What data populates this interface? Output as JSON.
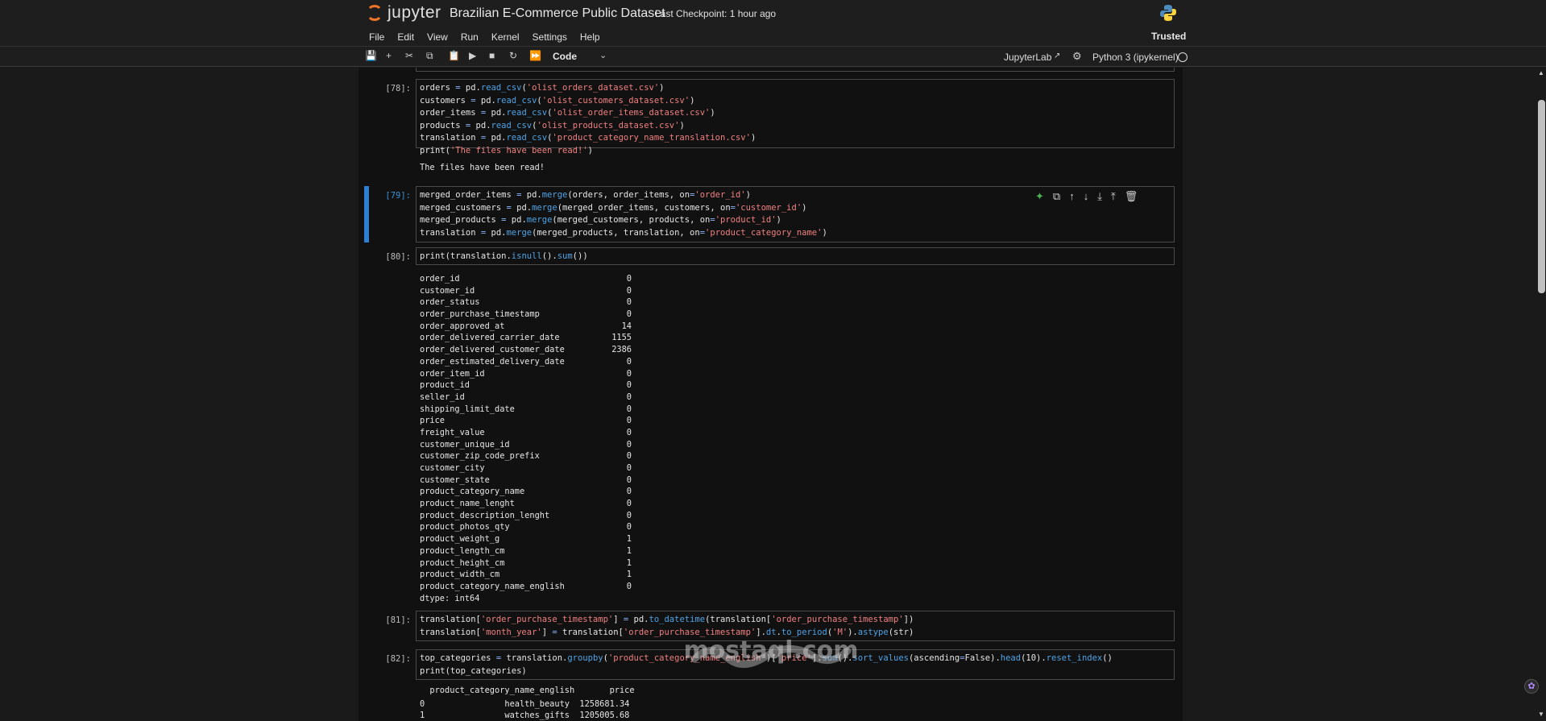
{
  "header": {
    "logo_text": "jupyter",
    "notebook_title": "Brazilian E-Commerce Public Dataset",
    "checkpoint": "Last Checkpoint: 1 hour ago",
    "trusted": "Trusted"
  },
  "menu": [
    "File",
    "Edit",
    "View",
    "Run",
    "Kernel",
    "Settings",
    "Help"
  ],
  "toolbar": {
    "cell_type": "Code",
    "jupyterlab_label": "JupyterLab",
    "kernel_label": "Python 3 (ipykernel)"
  },
  "cells": {
    "c78": {
      "prompt": "[78]:",
      "output": "The files have been read!"
    },
    "c79": {
      "prompt": "[79]:"
    },
    "c80": {
      "prompt": "[80]:",
      "series": [
        {
          "name": "order_id",
          "value": "0"
        },
        {
          "name": "customer_id",
          "value": "0"
        },
        {
          "name": "order_status",
          "value": "0"
        },
        {
          "name": "order_purchase_timestamp",
          "value": "0"
        },
        {
          "name": "order_approved_at",
          "value": "14"
        },
        {
          "name": "order_delivered_carrier_date",
          "value": "1155"
        },
        {
          "name": "order_delivered_customer_date",
          "value": "2386"
        },
        {
          "name": "order_estimated_delivery_date",
          "value": "0"
        },
        {
          "name": "order_item_id",
          "value": "0"
        },
        {
          "name": "product_id",
          "value": "0"
        },
        {
          "name": "seller_id",
          "value": "0"
        },
        {
          "name": "shipping_limit_date",
          "value": "0"
        },
        {
          "name": "price",
          "value": "0"
        },
        {
          "name": "freight_value",
          "value": "0"
        },
        {
          "name": "customer_unique_id",
          "value": "0"
        },
        {
          "name": "customer_zip_code_prefix",
          "value": "0"
        },
        {
          "name": "customer_city",
          "value": "0"
        },
        {
          "name": "customer_state",
          "value": "0"
        },
        {
          "name": "product_category_name",
          "value": "0"
        },
        {
          "name": "product_name_lenght",
          "value": "0"
        },
        {
          "name": "product_description_lenght",
          "value": "0"
        },
        {
          "name": "product_photos_qty",
          "value": "0"
        },
        {
          "name": "product_weight_g",
          "value": "1"
        },
        {
          "name": "product_length_cm",
          "value": "1"
        },
        {
          "name": "product_height_cm",
          "value": "1"
        },
        {
          "name": "product_width_cm",
          "value": "1"
        },
        {
          "name": "product_category_name_english",
          "value": "0"
        }
      ],
      "dtype": "dtype: int64"
    },
    "c81": {
      "prompt": "[81]:"
    },
    "c82": {
      "prompt": "[82]:",
      "table_header": "  product_category_name_english       price",
      "rows": [
        "0                health_beauty  1258681.34",
        "1                watches_gifts  1205005.68"
      ]
    }
  },
  "watermark": "mostaql.com",
  "colors": {
    "accent_orange": "#f37726",
    "active_cell": "#2f7fd0",
    "string": "#f08080",
    "function": "#4fa3e6"
  }
}
